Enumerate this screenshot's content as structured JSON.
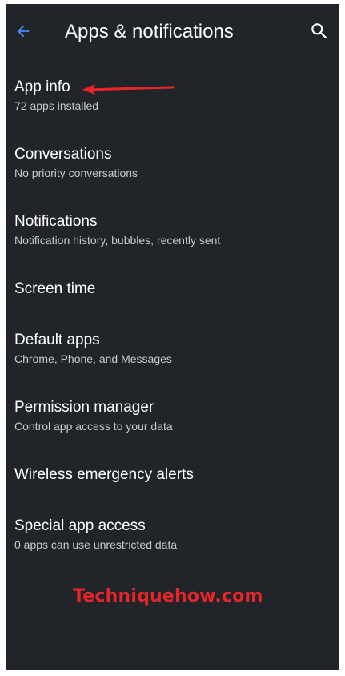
{
  "header": {
    "title": "Apps & notifications",
    "back_icon": "arrow-back-icon",
    "search_icon": "search-icon"
  },
  "items": [
    {
      "title": "App info",
      "subtitle": "72 apps installed"
    },
    {
      "title": "Conversations",
      "subtitle": "No priority conversations"
    },
    {
      "title": "Notifications",
      "subtitle": "Notification history, bubbles, recently sent"
    },
    {
      "title": "Screen time",
      "subtitle": ""
    },
    {
      "title": "Default apps",
      "subtitle": "Chrome, Phone, and Messages"
    },
    {
      "title": "Permission manager",
      "subtitle": "Control app access to your data"
    },
    {
      "title": "Wireless emergency alerts",
      "subtitle": ""
    },
    {
      "title": "Special app access",
      "subtitle": "0 apps can use unrestricted data"
    }
  ],
  "watermark": "Techniquehow.com",
  "colors": {
    "background": "#212529",
    "accent": "#4a8af4",
    "annotation": "#e8252b",
    "text_primary": "#ffffff",
    "text_secondary": "#c7c9cc"
  }
}
